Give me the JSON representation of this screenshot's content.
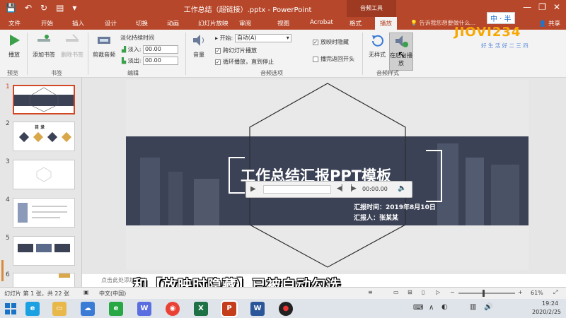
{
  "titlebar": {
    "doc_title": "工作总结（超链接）.pptx - PowerPoint",
    "context_tab": "音频工具",
    "minimize": "—",
    "restore": "❐",
    "close": "✕"
  },
  "tabs": [
    "文件",
    "开始",
    "插入",
    "设计",
    "切换",
    "动画",
    "幻灯片放映",
    "审阅",
    "视图",
    "Acrobat",
    "格式",
    "播放"
  ],
  "active_tab": "播放",
  "search_placeholder": "告诉我您想要做什么...",
  "share_label": "共享",
  "ribbon": {
    "preview": {
      "play_label": "播放",
      "group": "预览"
    },
    "bookmarks": {
      "add_label": "添加书签",
      "remove_label": "删除书签",
      "group": "书签"
    },
    "editing": {
      "trim_label": "剪裁音频",
      "fade_title": "淡化持续时间",
      "fade_in_label": "淡入:",
      "fade_in_value": "00.00",
      "fade_out_label": "淡出:",
      "fade_out_value": "00.00",
      "group": "编辑"
    },
    "audio_options": {
      "volume_label": "音量",
      "start_label": "开始:",
      "start_value": "自动(A)",
      "cross_slides_label": "跨幻灯片播放",
      "cross_slides_checked": true,
      "loop_label": "循环播放，直到停止",
      "loop_checked": true,
      "hide_label": "放映时隐藏",
      "hide_checked": true,
      "rewind_label": "播完返回开头",
      "rewind_checked": false,
      "group": "音频选项"
    },
    "audio_styles": {
      "none_label": "无样式",
      "bg_label": "在后台播放",
      "group": "音频样式"
    }
  },
  "slides": [
    {
      "num": "1",
      "active": true
    },
    {
      "num": "2",
      "active": false,
      "heading": "目 录"
    },
    {
      "num": "3",
      "active": false
    },
    {
      "num": "4",
      "active": false
    },
    {
      "num": "5",
      "active": false
    },
    {
      "num": "6",
      "active": false
    }
  ],
  "slide": {
    "title": "工作总结汇报PPT模板",
    "report_time": "汇报时间：2019年8月10日",
    "reporter": "汇报人：张某某"
  },
  "player": {
    "time": "00:00.00"
  },
  "notes_placeholder": "点击此处添加备注",
  "caption": "和【放映时隐藏】已被自动勾选",
  "status": {
    "slide_info": "幻灯片 第 1 张，共 22 张",
    "language": "中文(中国)",
    "zoom": "61%"
  },
  "taskbar": {
    "time": "19:24",
    "date": "2020/2/25"
  },
  "watermark": {
    "brand": "JIOVI234",
    "slogan": "好 生 活 好 二 三 四",
    "ime": "中 · 半"
  },
  "colors": {
    "ppt_accent": "#b7472a",
    "band": "#3c4256",
    "active_thumb": "#d24726"
  }
}
